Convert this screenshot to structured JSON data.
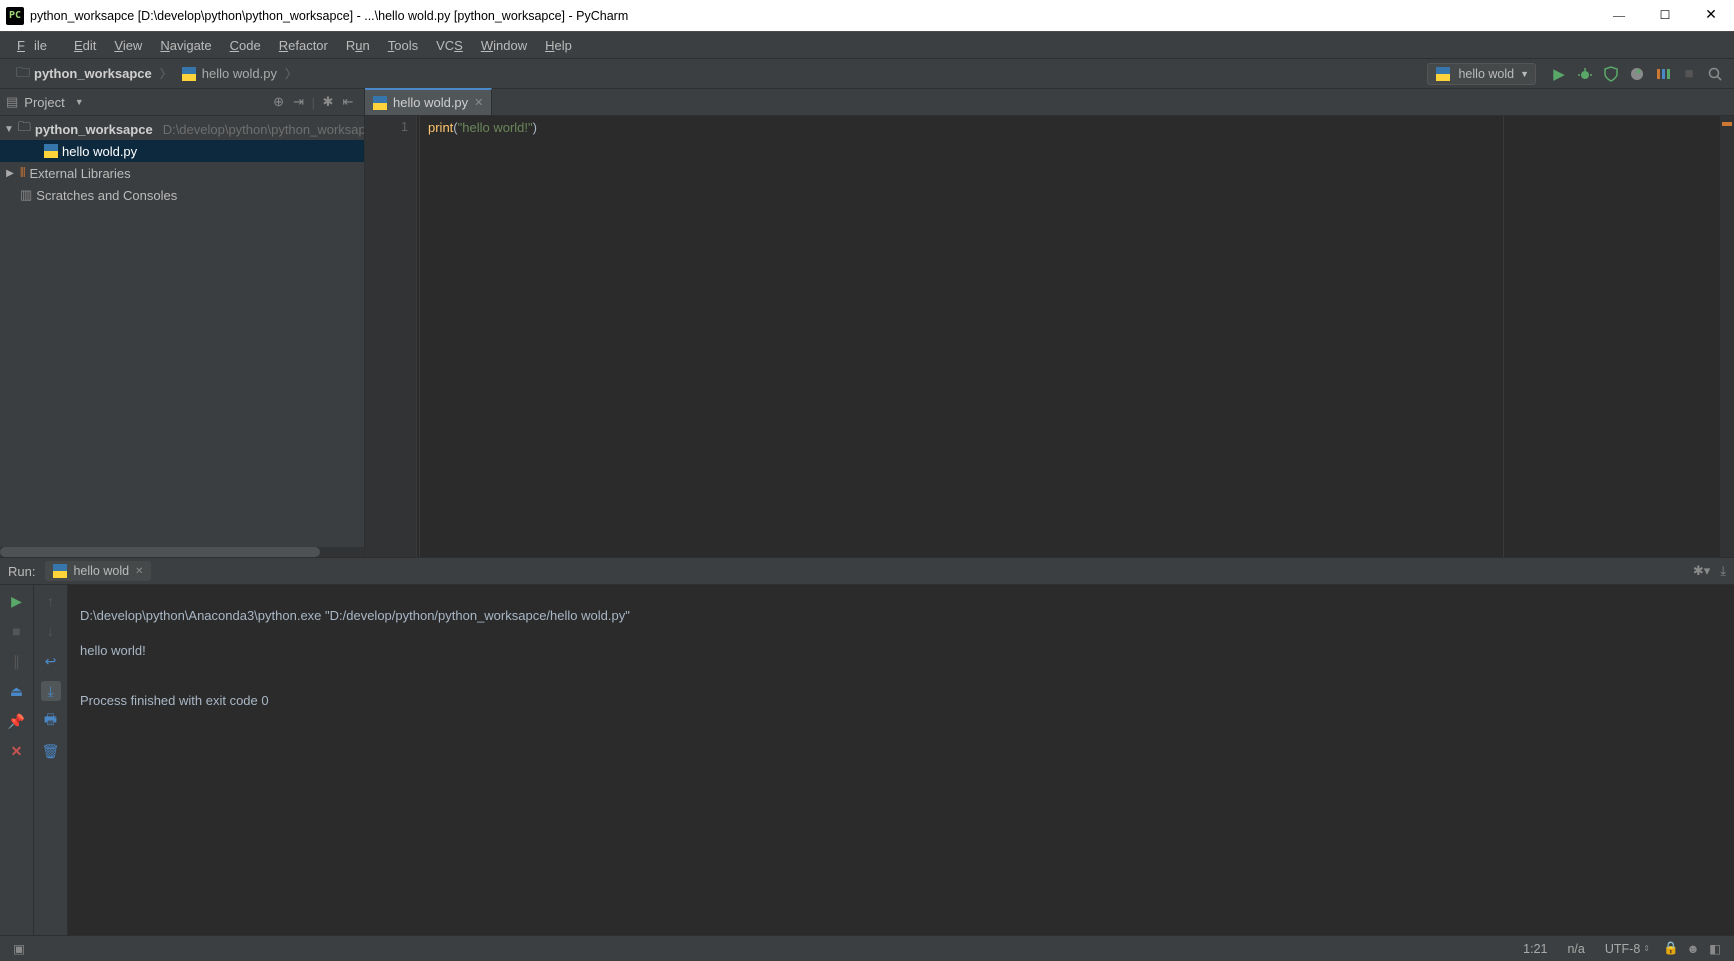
{
  "window": {
    "title": "python_worksapce [D:\\develop\\python\\python_worksapce] - ...\\hello wold.py [python_worksapce] - PyCharm"
  },
  "menu": {
    "items": [
      "File",
      "Edit",
      "View",
      "Navigate",
      "Code",
      "Refactor",
      "Run",
      "Tools",
      "VCS",
      "Window",
      "Help"
    ]
  },
  "breadcrumb": {
    "project": "python_worksapce",
    "file": "hello wold.py"
  },
  "toolbar": {
    "run_config": "hello wold"
  },
  "project_panel": {
    "title": "Project",
    "root": "python_worksapce",
    "root_path": "D:\\develop\\python\\python_worksapce",
    "file": "hello wold.py",
    "external": "External Libraries",
    "scratches": "Scratches and Consoles"
  },
  "editor": {
    "tab": "hello wold.py",
    "line_number": "1",
    "code": {
      "fn": "print",
      "open": "(",
      "str": "\"hello world!\"",
      "close": ")"
    }
  },
  "run_panel": {
    "label": "Run:",
    "tab": "hello wold",
    "line1": "D:\\develop\\python\\Anaconda3\\python.exe \"D:/develop/python/python_worksapce/hello wold.py\"",
    "line2": "hello world!",
    "line3": "",
    "line4": "Process finished with exit code 0"
  },
  "status": {
    "position": "1:21",
    "context": "n/a",
    "encoding": "UTF-8"
  }
}
